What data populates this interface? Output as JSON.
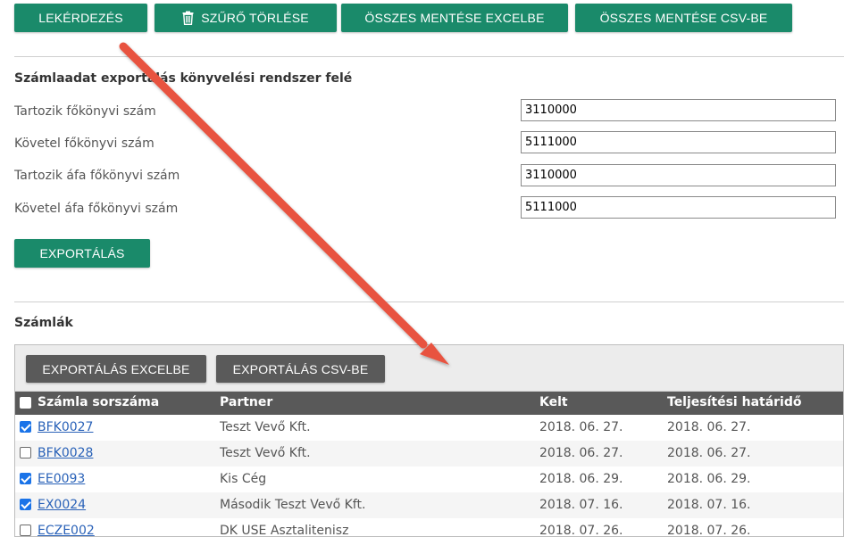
{
  "toolbar": {
    "query_label": "LEKÉRDEZÉS",
    "clear_filter_label": "SZŰRŐ TÖRLÉSE",
    "save_all_excel_label": "ÖSSZES MENTÉSE EXCELBE",
    "save_all_csv_label": "ÖSSZES MENTÉSE CSV-BE"
  },
  "export_section": {
    "title": "Számlaadat exportálás könyvelési rendszer felé",
    "fields": [
      {
        "label": "Tartozik főkönyvi szám",
        "value": "3110000"
      },
      {
        "label": "Követel főkönyvi szám",
        "value": "5111000"
      },
      {
        "label": "Tartozik áfa főkönyvi szám",
        "value": "3110000"
      },
      {
        "label": "Követel áfa főkönyvi szám",
        "value": "5111000"
      }
    ],
    "export_label": "EXPORTÁLÁS"
  },
  "invoices": {
    "title": "Számlák",
    "export_excel_label": "EXPORTÁLÁS EXCELBE",
    "export_csv_label": "EXPORTÁLÁS CSV-BE",
    "columns": [
      "Számla sorszáma",
      "Partner",
      "Kelt",
      "Teljesítési határidő"
    ],
    "rows": [
      {
        "checked": true,
        "number": "BFK0027",
        "partner": "Teszt Vevő Kft.",
        "date": "2018. 06. 27.",
        "due": "2018. 06. 27."
      },
      {
        "checked": false,
        "number": "BFK0028",
        "partner": "Teszt Vevő Kft.",
        "date": "2018. 06. 27.",
        "due": "2018. 06. 27."
      },
      {
        "checked": true,
        "number": "EE0093",
        "partner": "Kis Cég",
        "date": "2018. 06. 29.",
        "due": "2018. 06. 29."
      },
      {
        "checked": true,
        "number": "EX0024",
        "partner": "Második Teszt Vevő Kft.",
        "date": "2018. 07. 16.",
        "due": "2018. 07. 16."
      },
      {
        "checked": false,
        "number": "ECZE002",
        "partner": "DK USE Asztalitenisz",
        "date": "2018. 07. 26.",
        "due": "2018. 07. 26."
      }
    ]
  },
  "colors": {
    "accent_green": "#1a8a6a",
    "toolbar_gray": "#5a5a5a",
    "annotation_arrow": "#e8523f"
  },
  "icons": {
    "clear_filter": "trash-icon",
    "annotation": "arrow-annotation"
  }
}
